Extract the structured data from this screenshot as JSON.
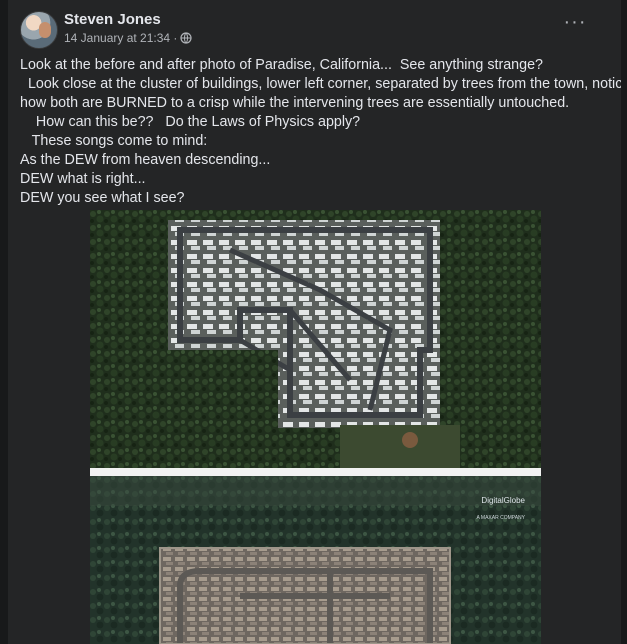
{
  "post": {
    "author": "Steven Jones",
    "timestamp": "14 January at 21:34 ·",
    "audience_icon": "globe-icon",
    "more_icon": "more-options-icon",
    "lines": [
      "Look at the before and after photo of Paradise, California...  See anything strange?",
      "  Look close at the cluster of buildings, lower left corner, separated by trees from the town, notice",
      "how both are BURNED to a crisp while the intervening trees are essentially untouched.",
      "    How can this be??   Do the Laws of Physics apply?",
      "   These songs come to mind:",
      "As the DEW from heaven descending...",
      "DEW what is right...",
      "DEW you see what I see?"
    ]
  },
  "image": {
    "watermark": "DigitalGlobe",
    "watermark_sub": "A MAXAR COMPANY"
  },
  "colors": {
    "background": "#18191a",
    "card": "#242526",
    "text_primary": "#e4e6eb",
    "text_secondary": "#b0b3b8"
  }
}
